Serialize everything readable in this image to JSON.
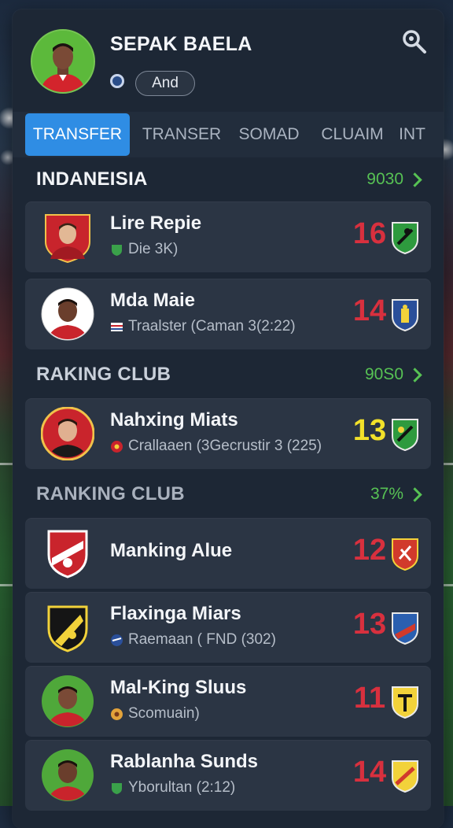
{
  "header": {
    "title": "SEPAK BAELA",
    "chip_label": "And"
  },
  "tabs": [
    {
      "label": "TRANSFER",
      "active": true
    },
    {
      "label": "TRANSER",
      "active": false
    },
    {
      "label": "SOMAD",
      "active": false
    },
    {
      "label": "CLUAIM",
      "active": false
    },
    {
      "label": "INT",
      "active": false
    }
  ],
  "sections": [
    {
      "title": "INDANEISIA",
      "link": "9030"
    },
    {
      "title": "RAKING CLUB",
      "link": "90S0"
    },
    {
      "title": "RANKING CLUB",
      "link": "37%"
    }
  ],
  "players": [
    {
      "name": "Lire Repie",
      "sub": "Die 3K)",
      "number": "16",
      "number_color": "#d8303e",
      "avatar": "player-shield-red",
      "badge": "green-shield"
    },
    {
      "name": "Mda Maie",
      "sub": "Traalster (Caman 3(2:22)",
      "number": "14",
      "number_color": "#d8303e",
      "avatar": "player-circle-white",
      "badge": "blue-shield"
    },
    {
      "name": "Nahxing Miats",
      "sub": "Crallaaen (3Gecrustir 3 (225)",
      "number": "13",
      "number_color": "#f2e12a",
      "avatar": "player-circle-red",
      "badge": "green-shield"
    },
    {
      "name": "Manking Alue",
      "sub": "",
      "number": "12",
      "number_color": "#d8303e",
      "avatar": "club-crest-red",
      "badge": "red-shield"
    },
    {
      "name": "Flaxinga Miars",
      "sub": "Raemaan ( FND (302)",
      "number": "13",
      "number_color": "#d8303e",
      "avatar": "club-crest-black",
      "badge": "blue-red-shield"
    },
    {
      "name": "Mal-King Sluus",
      "sub": "Scomuain)",
      "number": "11",
      "number_color": "#d8303e",
      "avatar": "player-circle-green",
      "badge": "yellow-shield"
    },
    {
      "name": "Rablanha Sunds",
      "sub": "Yborultan (2:12)",
      "number": "14",
      "number_color": "#d8303e",
      "avatar": "player-circle-green",
      "badge": "yellow-red-shield"
    }
  ],
  "colors": {
    "accent": "#2f8de4",
    "positive": "#57c254",
    "number_red": "#d8303e",
    "number_yellow": "#f2e12a",
    "panel": "#1d2735",
    "card": "#2b3544"
  }
}
